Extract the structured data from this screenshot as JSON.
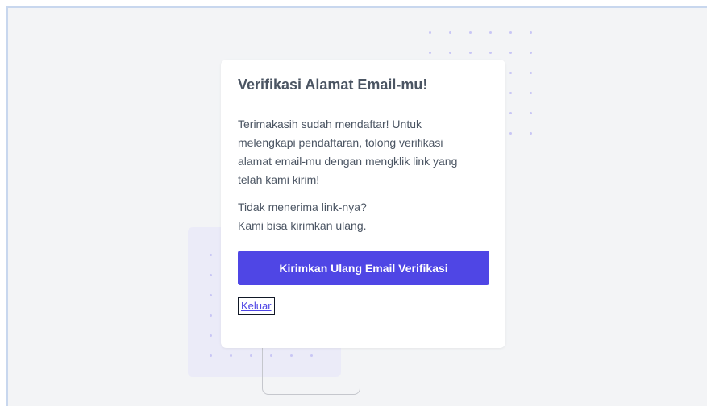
{
  "card": {
    "title": "Verifikasi Alamat Email-mu!",
    "message_lines": [
      "Terimakasih sudah mendaftar! Untuk",
      "melengkapi pendaftaran, tolong verifikasi",
      "alamat email-mu dengan mengklik link yang",
      "telah kami kirim!"
    ],
    "resend_prompt_lines": [
      "Tidak menerima link-nya?",
      "Kami bisa kirimkan ulang."
    ],
    "resend_button_label": "Kirimkan Ulang Email Verifikasi",
    "logout_label": "Keluar"
  },
  "colors": {
    "background": "#f3f4f6",
    "card": "#ffffff",
    "accent": "#4f46e5",
    "text": "#4b5563",
    "decor_dots": "#c9c6f5",
    "decor_rect": "#ebebf8"
  }
}
